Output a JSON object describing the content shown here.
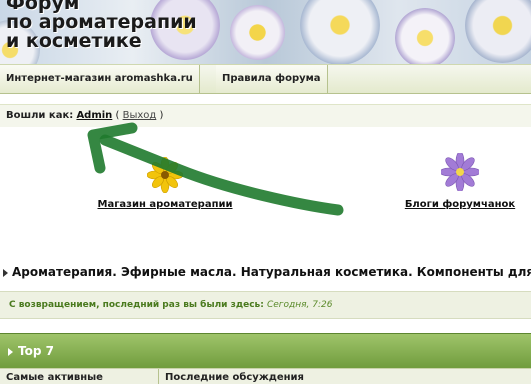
{
  "banner": {
    "title_lines": [
      "Форум",
      "по ароматерапии",
      "и косметике"
    ]
  },
  "nav": {
    "items": [
      {
        "label": "Интернет-магазин aromashka.ru"
      },
      {
        "label": "Правила форума"
      }
    ]
  },
  "login": {
    "prefix": "Вошли как:",
    "user": "Admin",
    "paren_open": "(",
    "exit": "Выход",
    "paren_close": ")"
  },
  "links": [
    {
      "label": "Магазин ароматерапии",
      "icon": "yellow-flower-icon"
    },
    {
      "label": "Блоги форумчанок",
      "icon": "purple-flower-icon"
    }
  ],
  "marquee": {
    "text": "Ароматерапия. Эфирные масла. Натуральная косметика. Компоненты для к"
  },
  "welcome": {
    "text": "С возвращением, последний раз вы были здесь:",
    "time": "Сегодня, 7:26"
  },
  "top7": {
    "title": "Top 7"
  },
  "columns": {
    "left": "Самые активные",
    "right": "Последние обсуждения"
  },
  "colors": {
    "accent_green": "#6f9b3c",
    "annotation_arrow": "#1f7a2e"
  }
}
